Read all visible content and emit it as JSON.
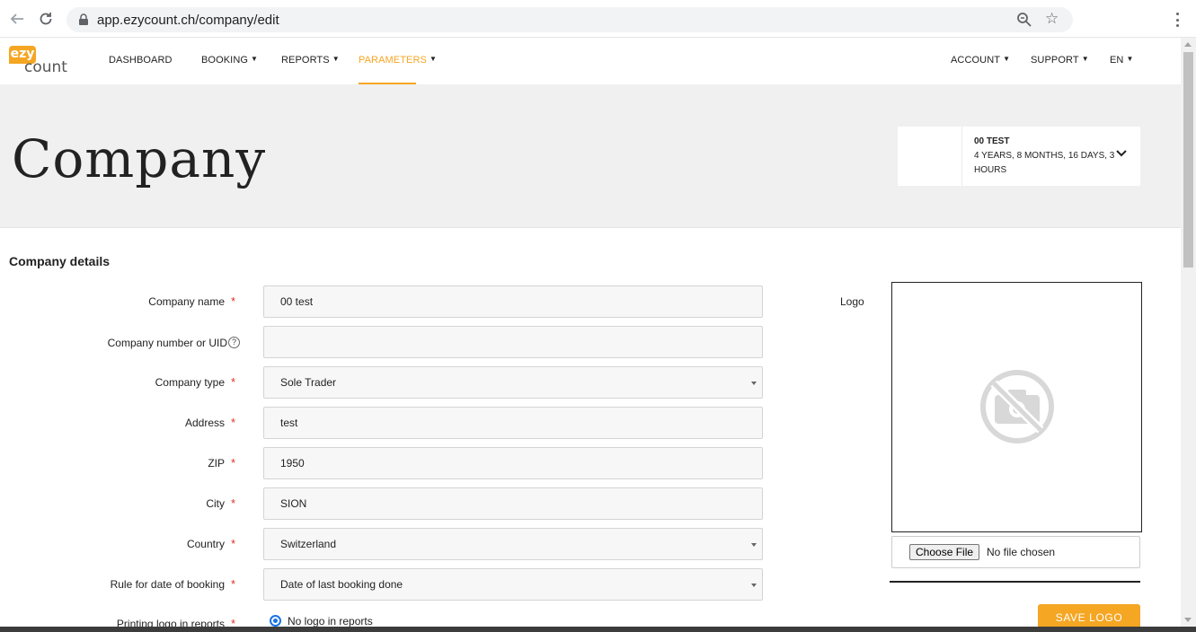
{
  "browser": {
    "url": "app.ezycount.ch/company/edit"
  },
  "logo": {
    "top": "ezy",
    "bottom": "count",
    "brand_color": "#f5a623"
  },
  "nav": {
    "left": [
      {
        "label": "DASHBOARD",
        "caret": ""
      },
      {
        "label": "BOOKING",
        "caret": "▼"
      },
      {
        "label": "REPORTS",
        "caret": "▼"
      },
      {
        "label": "PARAMETERS",
        "caret": "▼"
      }
    ],
    "right": [
      {
        "label": "ACCOUNT",
        "caret": "▼"
      },
      {
        "label": "SUPPORT",
        "caret": "▼"
      },
      {
        "label": "EN",
        "caret": "▼"
      }
    ],
    "active": "PARAMETERS"
  },
  "header": {
    "title": "Company",
    "period": {
      "name": "00 TEST",
      "duration": "4 YEARS, 8 MONTHS, 16 DAYS, 3 HOURS"
    }
  },
  "form": {
    "section_title": "Company details",
    "fields": [
      {
        "label": "Company name",
        "required": "*",
        "value": "00 test"
      },
      {
        "label": "Company number or UID",
        "help": "?",
        "value": ""
      },
      {
        "label": "Company type",
        "required": "*",
        "value": "Sole Trader"
      },
      {
        "label": "Address",
        "required": "*",
        "value": "test"
      },
      {
        "label": "ZIP",
        "required": "*",
        "value": "1950"
      },
      {
        "label": "City",
        "required": "*",
        "value": "SION"
      },
      {
        "label": "Country",
        "required": "*",
        "value": "Switzerland"
      },
      {
        "label": "Rule for date of booking",
        "required": "*",
        "value": "Date of last booking done"
      },
      {
        "label": "Printing logo in reports",
        "required": "*",
        "value": "No logo in reports"
      }
    ]
  },
  "logo_upload": {
    "label": "Logo",
    "choose_file": "Choose File",
    "status": "No file chosen",
    "save": "SAVE LOGO"
  }
}
